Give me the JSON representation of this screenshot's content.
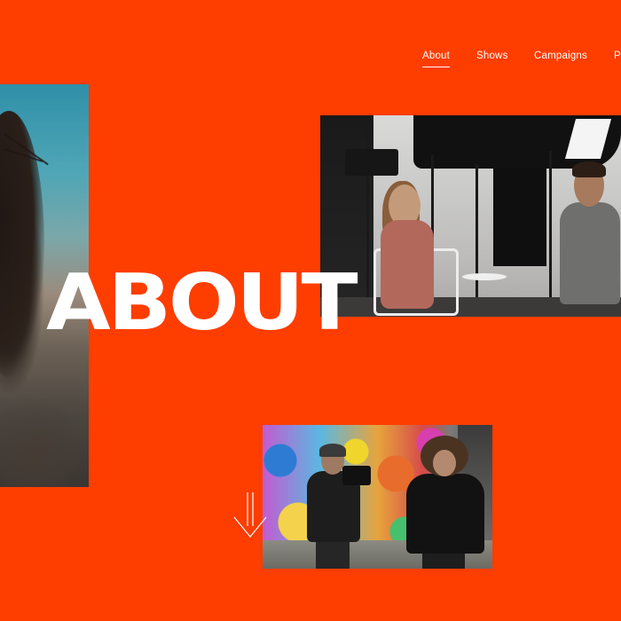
{
  "nav": {
    "items": [
      {
        "label": "About",
        "active": true
      },
      {
        "label": "Shows",
        "active": false
      },
      {
        "label": "Campaigns",
        "active": false
      },
      {
        "label": "P",
        "active": false
      }
    ]
  },
  "hero": {
    "title": "ABOUT"
  },
  "photos": {
    "portrait": "close-up portrait photo",
    "interview": "studio interview photo",
    "graffiti": "camera crew filming in front of graffiti wall"
  },
  "icons": {
    "scroll": "arrow-down-icon"
  },
  "colors": {
    "background": "#fe3d00",
    "text": "#ffffff"
  }
}
